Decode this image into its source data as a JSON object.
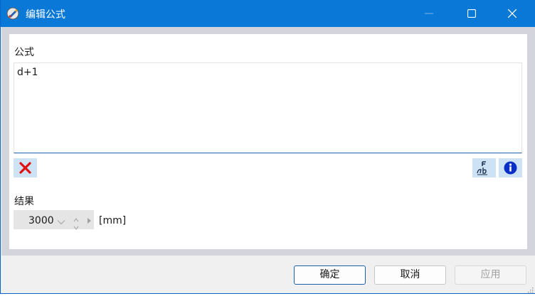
{
  "window": {
    "title": "编辑公式",
    "accent_color": "#0a78d7",
    "icons": {
      "app": "formula-app-icon",
      "minimize": "minimize-icon",
      "maximize": "maximize-icon",
      "close": "close-icon"
    }
  },
  "formula": {
    "label": "公式",
    "value": "d+1"
  },
  "tools": {
    "clear_icon": "red-x-icon",
    "ab_icon": "ab-formula-icon",
    "info_icon": "info-icon"
  },
  "result": {
    "label": "结果",
    "value": "3000",
    "unit": "[mm]"
  },
  "buttons": {
    "ok": "确定",
    "cancel": "取消",
    "apply": "应用"
  }
}
